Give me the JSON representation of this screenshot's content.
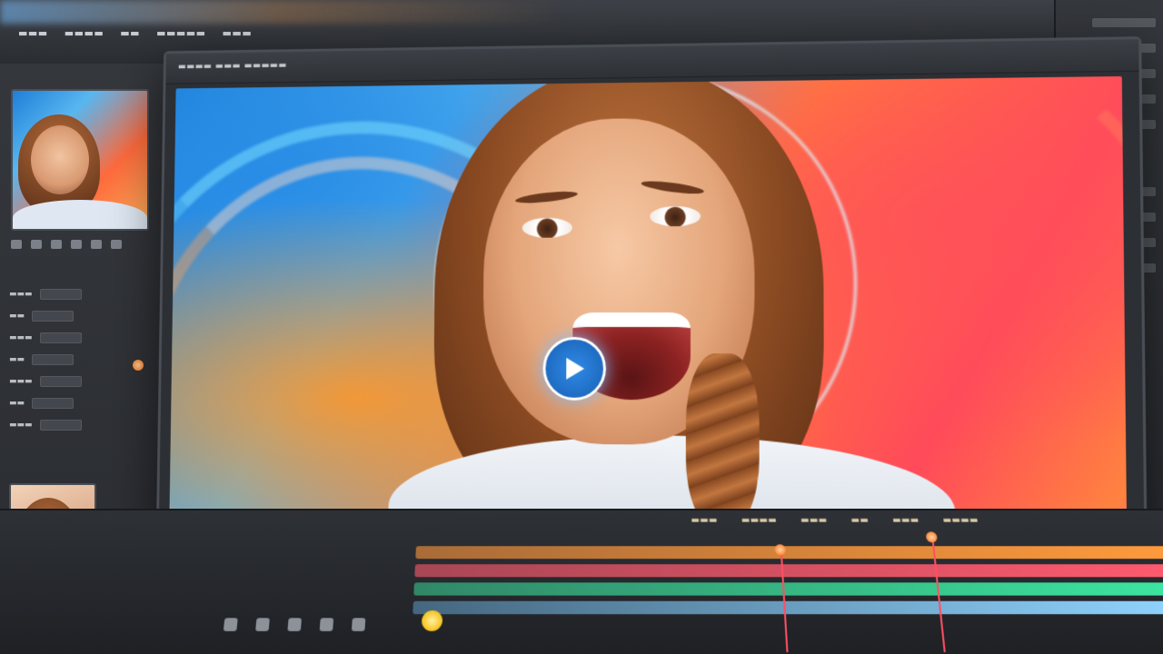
{
  "colors": {
    "accent_blue": "#2f8ae6",
    "track_red": "#ff5a6e",
    "track_orange": "#ff9a3c",
    "track_green": "#3ce6a0",
    "playhead": "#ff4f63"
  },
  "icons": {
    "play": "play-icon",
    "thumbnail": "thumbnail-icon"
  }
}
